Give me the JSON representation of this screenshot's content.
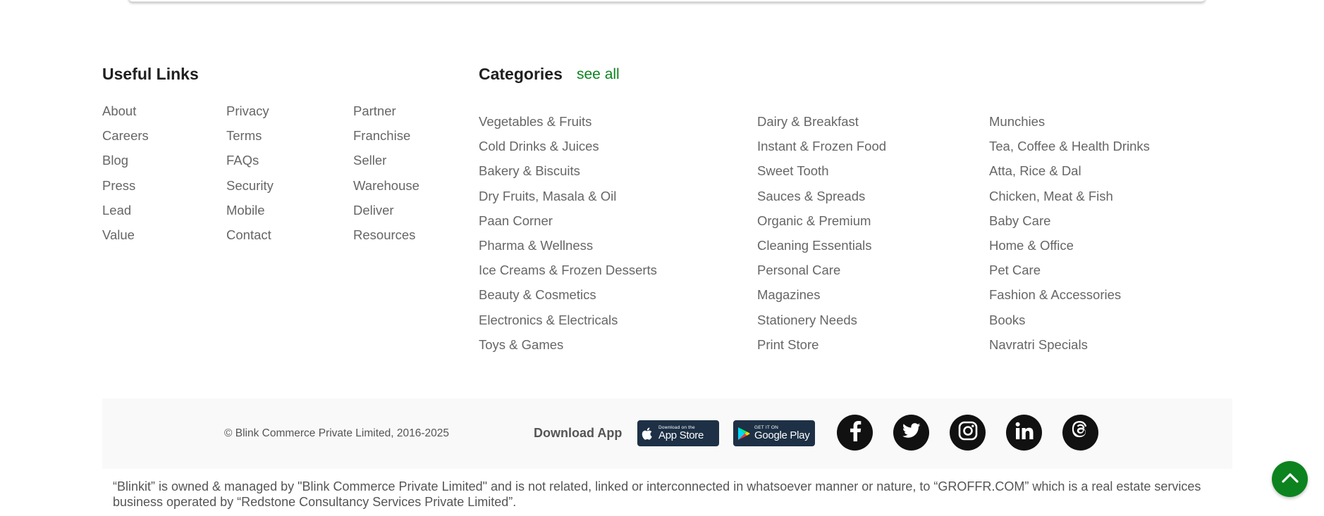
{
  "useful_links": {
    "title": "Useful Links",
    "columns": [
      [
        "About",
        "Careers",
        "Blog",
        "Press",
        "Lead",
        "Value"
      ],
      [
        "Privacy",
        "Terms",
        "FAQs",
        "Security",
        "Mobile",
        "Contact"
      ],
      [
        "Partner",
        "Franchise",
        "Seller",
        "Warehouse",
        "Deliver",
        "Resources"
      ]
    ]
  },
  "categories": {
    "title": "Categories",
    "see_all": "see all",
    "columns": [
      [
        "Vegetables & Fruits",
        "Cold Drinks & Juices",
        "Bakery & Biscuits",
        "Dry Fruits, Masala & Oil",
        "Paan Corner",
        "Pharma & Wellness",
        "Ice Creams & Frozen Desserts",
        "Beauty & Cosmetics",
        "Electronics & Electricals",
        "Toys & Games"
      ],
      [
        "Dairy & Breakfast",
        "Instant & Frozen Food",
        "Sweet Tooth",
        "Sauces & Spreads",
        "Organic & Premium",
        "Cleaning Essentials",
        "Personal Care",
        "Magazines",
        "Stationery Needs",
        "Print Store"
      ],
      [
        "Munchies",
        "Tea, Coffee & Health Drinks",
        "Atta, Rice & Dal",
        "Chicken, Meat & Fish",
        "Baby Care",
        "Home & Office",
        "Pet Care",
        "Fashion & Accessories",
        "Books",
        "Navratri Specials"
      ]
    ]
  },
  "footer": {
    "copyright": "© Blink Commerce Private Limited, 2016-2025",
    "download_label": "Download App",
    "app_store": {
      "small": "Download on the",
      "big": "App Store"
    },
    "google_play": {
      "small": "GET IT ON",
      "big": "Google Play"
    },
    "social_icons": [
      "facebook-icon",
      "twitter-icon",
      "instagram-icon",
      "linkedin-icon",
      "threads-icon"
    ],
    "disclaimer": "“Blinkit” is owned & managed by \"Blink Commerce Private Limited\" and is not related, linked or interconnected in whatsoever manner or nature, to “GROFFR.COM” which is a real estate services business operated by “Redstone Consultancy Services Private Limited”."
  },
  "colors": {
    "accent": "#0c831f",
    "text": "#666666",
    "heading": "#1f1f1f",
    "footer_bg": "#f9f9f9",
    "store_button": "#1d3045",
    "social_bg": "#111111"
  }
}
